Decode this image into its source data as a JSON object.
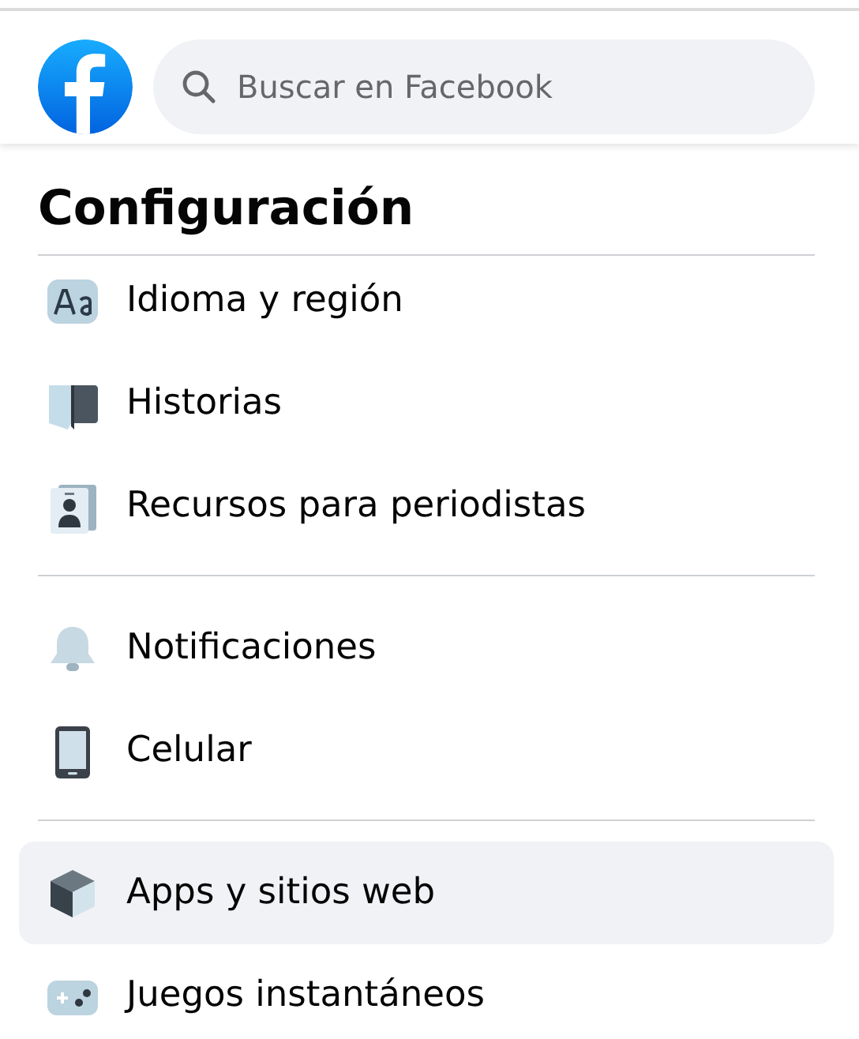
{
  "header": {
    "search": {
      "placeholder": "Buscar en Facebook"
    }
  },
  "title": "Configuración",
  "sections": [
    {
      "items": [
        {
          "label": "Idioma y región",
          "selected": false
        },
        {
          "label": "Historias",
          "selected": false
        },
        {
          "label": "Recursos para periodistas",
          "selected": false
        }
      ]
    },
    {
      "items": [
        {
          "label": "Notificaciones",
          "selected": false
        },
        {
          "label": "Celular",
          "selected": false
        }
      ]
    },
    {
      "items": [
        {
          "label": "Apps y sitios web",
          "selected": true
        },
        {
          "label": "Juegos instantáneos",
          "selected": false
        }
      ]
    }
  ]
}
